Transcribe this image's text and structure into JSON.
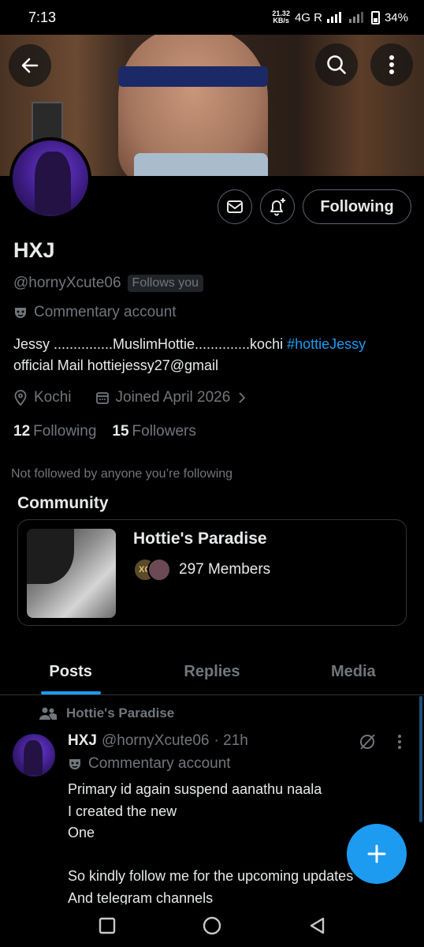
{
  "status_bar": {
    "time": "7:13",
    "speed_value": "21.32",
    "speed_unit": "KB/s",
    "network": "4G R",
    "battery": "34%"
  },
  "header": {
    "back_icon": "back-arrow-icon",
    "search_icon": "search-icon",
    "more_icon": "more-vertical-icon"
  },
  "profile": {
    "name": "HXJ",
    "handle": "@hornyXcute06",
    "follows_badge": "Follows you",
    "account_type": "Commentary account",
    "bio_line1_text": "Jessy ...............MuslimHottie..............kochi ",
    "bio_hashtag": "#hottieJessy",
    "bio_line2": "official Mail   hottiejessy27@gmail",
    "location": "Kochi",
    "joined": "Joined April 2026",
    "following_count": "12",
    "following_label": "Following",
    "followers_count": "15",
    "followers_label": "Followers",
    "not_followed_note": "Not followed by anyone you’re following",
    "following_button": "Following"
  },
  "community": {
    "section_title": "Community",
    "name": "Hottie's Paradise",
    "members": "297 Members",
    "member_badge": "XG"
  },
  "tabs": [
    {
      "label": "Posts",
      "active": true
    },
    {
      "label": "Replies",
      "active": false
    },
    {
      "label": "Media",
      "active": false
    }
  ],
  "post": {
    "context": "Hottie's Paradise",
    "author": "HXJ",
    "handle": "@hornyXcute06",
    "time": "· 21h",
    "account_type": "Commentary account",
    "text": "Primary id again suspend aanathu naala\nI created the new\nOne\n\nSo kindly follow me for the upcoming updates\nAnd telegram channels"
  },
  "colors": {
    "accent": "#1d9bf0",
    "text_primary": "#e7e9ea",
    "text_secondary": "#71767b",
    "background": "#000000",
    "border": "#2f3336"
  }
}
